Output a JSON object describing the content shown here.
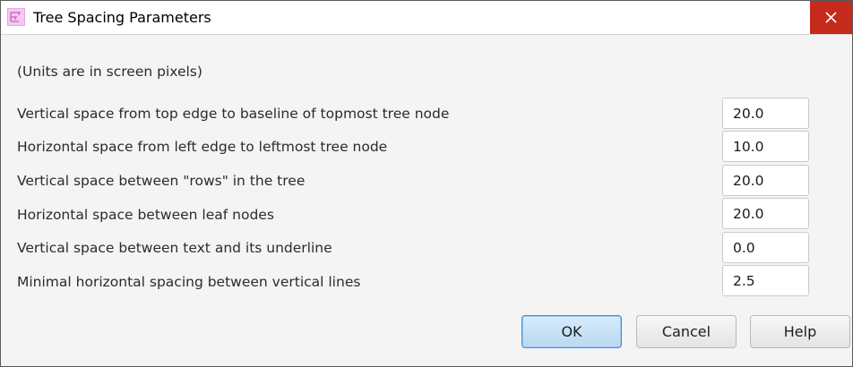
{
  "window": {
    "title": "Tree Spacing Parameters",
    "close_label": "✕"
  },
  "dialog": {
    "units_note": "(Units are in screen pixels)",
    "params": [
      {
        "label": "Vertical space from top edge to baseline of topmost tree node",
        "value": "20.0"
      },
      {
        "label": "Horizontal space from left edge to leftmost tree node",
        "value": "10.0"
      },
      {
        "label": "Vertical space between \"rows\" in the tree",
        "value": "20.0"
      },
      {
        "label": "Horizontal space between leaf nodes",
        "value": "20.0"
      },
      {
        "label": "Vertical space between text and its underline",
        "value": "0.0"
      },
      {
        "label": "Minimal horizontal spacing between vertical lines",
        "value": "2.5"
      }
    ]
  },
  "buttons": {
    "ok": "OK",
    "cancel": "Cancel",
    "help": "Help"
  },
  "colors": {
    "close_bg": "#c42b1c",
    "ok_border": "#3c8ed4",
    "app_icon": "#f6c8f4"
  },
  "icons": {
    "app": "tree-icon",
    "close": "close-icon"
  }
}
